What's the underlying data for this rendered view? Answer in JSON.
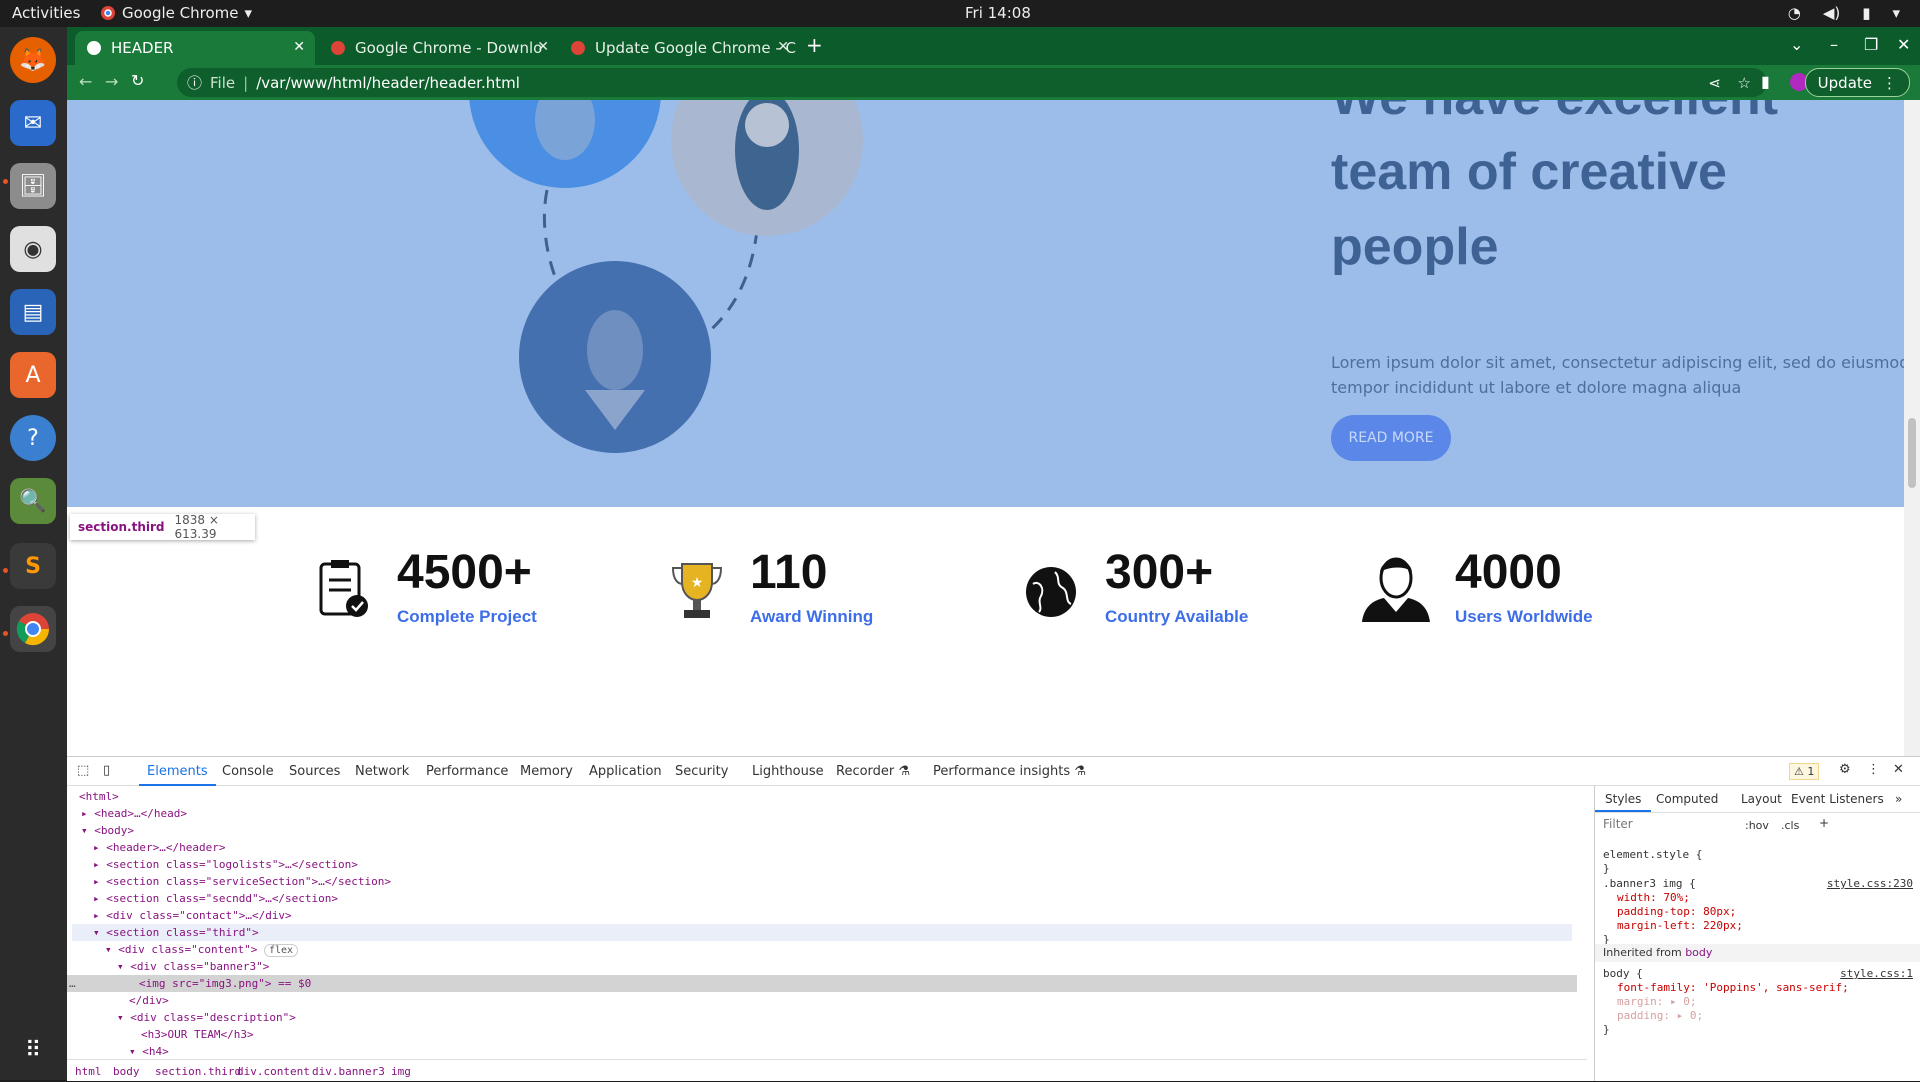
{
  "topbar": {
    "activities": "Activities",
    "app_name": "Google Chrome",
    "clock": "Fri 14:08"
  },
  "dock": {
    "items": [
      "Firefox",
      "Thunderbird",
      "Files",
      "Rhythmbox",
      "Writer",
      "Ubuntu Software",
      "Help",
      "Image Viewer",
      "Sublime Text",
      "Google Chrome",
      "Show Applications"
    ]
  },
  "browser": {
    "tabs": [
      {
        "title": "HEADER",
        "active": true
      },
      {
        "title": "Google Chrome - Downlo",
        "active": false
      },
      {
        "title": "Update Google Chrome - C",
        "active": false
      }
    ],
    "url_prefix": "File",
    "url": "/var/www/html/header/header.html",
    "update_label": "Update"
  },
  "page": {
    "hero_title": "We have excellent team of creative people",
    "hero_text": "Lorem ipsum dolor sit amet, consectetur adipiscing elit, sed do eiusmod tempor incididunt ut labore et dolore magna aliqua",
    "read_more": "READ MORE",
    "tooltip": {
      "selector": "section.third",
      "size": "1838 × 613.39"
    },
    "stats": [
      {
        "number": "4500+",
        "label": "Complete Project",
        "icon": "clipboard-check-icon"
      },
      {
        "number": "110",
        "label": "Award Winning",
        "icon": "trophy-icon"
      },
      {
        "number": "300+",
        "label": "Country Available",
        "icon": "globe-icon"
      },
      {
        "number": "4000",
        "label": "Users Worldwide",
        "icon": "user-suit-icon"
      }
    ]
  },
  "devtools": {
    "tabs": [
      "Elements",
      "Console",
      "Sources",
      "Network",
      "Performance",
      "Memory",
      "Application",
      "Security",
      "Lighthouse",
      "Recorder ⚗",
      "Performance insights ⚗"
    ],
    "warnings": "1",
    "dom_lines": [
      "<html>",
      "<head>…</head>",
      "<body>",
      "<header>…</header>",
      "<section class=\"logolists\">…</section>",
      "<section class=\"serviceSection\">…</section>",
      "<section class=\"secndd\">…</section>",
      "<div class=\"contact\">…</div>",
      "<section class=\"third\">",
      "<div class=\"content\">",
      "<div class=\"banner3\">",
      "<img src=\"img3.png\"> == $0",
      "</div>",
      "<div class=\"description\">",
      "<h3>OUR TEAM</h3>",
      "<h4>"
    ],
    "flex_badge": "flex",
    "styles_tabs": [
      "Styles",
      "Computed",
      "Layout",
      "Event Listeners",
      "»"
    ],
    "filter_placeholder": "Filter",
    "hov": ":hov",
    "cls": ".cls",
    "rules": {
      "element_style": "element.style {",
      "banner_selector": ".banner3 img {",
      "banner_source": "style.css:230",
      "banner_props": [
        "width: 70%;",
        "padding-top: 80px;",
        "margin-left: 220px;"
      ],
      "inherited": "Inherited from",
      "inherited_from": "body",
      "body_selector": "body {",
      "body_source": "style.css:1",
      "body_props": [
        "font-family: 'Poppins', sans-serif;",
        "margin: ▸ 0;",
        "padding: ▸ 0;"
      ],
      "close": "}"
    },
    "breadcrumbs": [
      "html",
      "body",
      "section.third",
      "div.content",
      "div.banner3",
      "img"
    ]
  }
}
